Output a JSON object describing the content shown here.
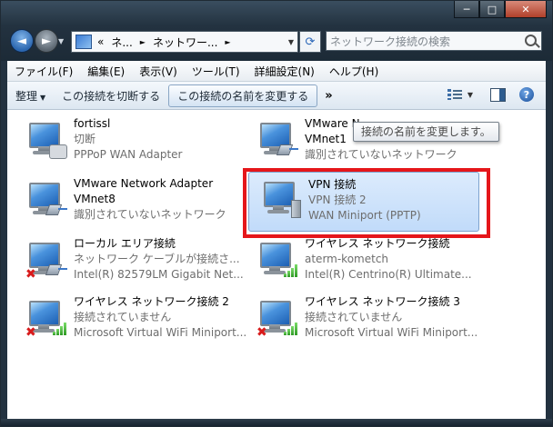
{
  "window": {
    "caption_buttons": {
      "minimize": "─",
      "maximize": "□",
      "close": "✕"
    },
    "icons": {
      "back": "arrow-left",
      "forward": "arrow-right",
      "refresh": "refresh-arrows",
      "search": "magnifier"
    }
  },
  "nav": {
    "back_glyph": "◄",
    "forward_glyph": "►",
    "dropdown_glyph": "▼",
    "refresh_glyph": "⟳"
  },
  "address": {
    "prefix": "«",
    "segment1": "ネ...",
    "sep1": "►",
    "segment2": "ネットワー...",
    "sep2": "►",
    "dropdown": "▼"
  },
  "search": {
    "placeholder": "ネットワーク接続の検索"
  },
  "menubar": {
    "items": [
      "ファイル(F)",
      "編集(E)",
      "表示(V)",
      "ツール(T)",
      "詳細設定(N)",
      "ヘルプ(H)"
    ]
  },
  "toolbar": {
    "organize": "整理",
    "organize_arrow": "▼",
    "disconnect": "この接続を切断する",
    "rename": "この接続の名前を変更する",
    "more": "»",
    "view_dropdown": "▼",
    "help": "?"
  },
  "tooltip": {
    "text": "接続の名前を変更します。"
  },
  "connections": [
    {
      "name": "fortissl",
      "status": "切断",
      "device": "PPPoP WAN Adapter",
      "icon": "dialup-modem-icon"
    },
    {
      "name": "VMware N",
      "status": "VMnet1",
      "device": "識別されていないネットワーク",
      "icon": "wired-network-icon"
    },
    {
      "name": "VMware Network Adapter",
      "status": "VMnet8",
      "device": "識別されていないネットワーク",
      "icon": "wired-network-icon"
    },
    {
      "name": "VPN 接続",
      "status": "VPN 接続 2",
      "device": "WAN Miniport (PPTP)",
      "icon": "vpn-server-icon",
      "selected": true
    },
    {
      "name": "ローカル エリア接続",
      "status": "ネットワーク ケーブルが接続さ...",
      "device": "Intel(R) 82579LM Gigabit Net...",
      "icon": "wired-disconnected-icon"
    },
    {
      "name": "ワイヤレス ネットワーク接続",
      "status": "aterm-kometch",
      "device": "Intel(R) Centrino(R) Ultimate...",
      "icon": "wireless-connected-icon"
    },
    {
      "name": "ワイヤレス ネットワーク接続 2",
      "status": "接続されていません",
      "device": "Microsoft Virtual WiFi Miniport...",
      "icon": "wireless-disconnected-icon"
    },
    {
      "name": "ワイヤレス ネットワーク接続 3",
      "status": "接続されていません",
      "device": "Microsoft Virtual WiFi Miniport...",
      "icon": "wireless-disconnected-icon"
    }
  ],
  "marks": {
    "x": "✖"
  },
  "colors": {
    "highlight": "#e5161a",
    "selected_bg": "#c1dbfa",
    "frame": "#1c2a36"
  }
}
